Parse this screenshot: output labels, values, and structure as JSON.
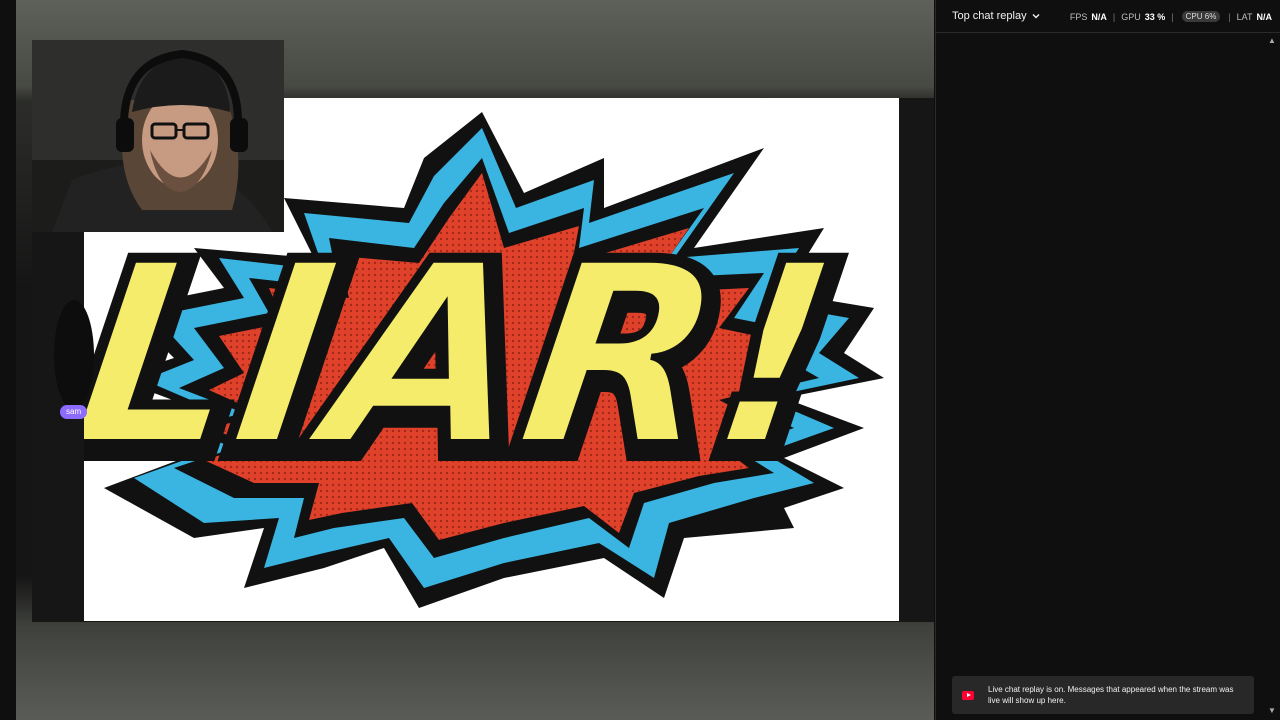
{
  "chat": {
    "mode_label": "Top chat replay",
    "replay_notice": "Live chat replay is on. Messages that appeared when the stream was live will show up here."
  },
  "perf": {
    "fps_label": "FPS",
    "fps_value": "N/A",
    "gpu_label": "GPU",
    "gpu_value": "33 %",
    "pill_text": "CPU 6%",
    "lat_label": "LAT",
    "lat_value": "N/A"
  },
  "video": {
    "graphic_text": "LIAR!",
    "overlay_badge": "sam"
  },
  "colors": {
    "comic_yellow": "#f4ec6a",
    "comic_blue": "#3ab4e0",
    "comic_red": "#e0412a",
    "youtube_red": "#ff0033"
  }
}
